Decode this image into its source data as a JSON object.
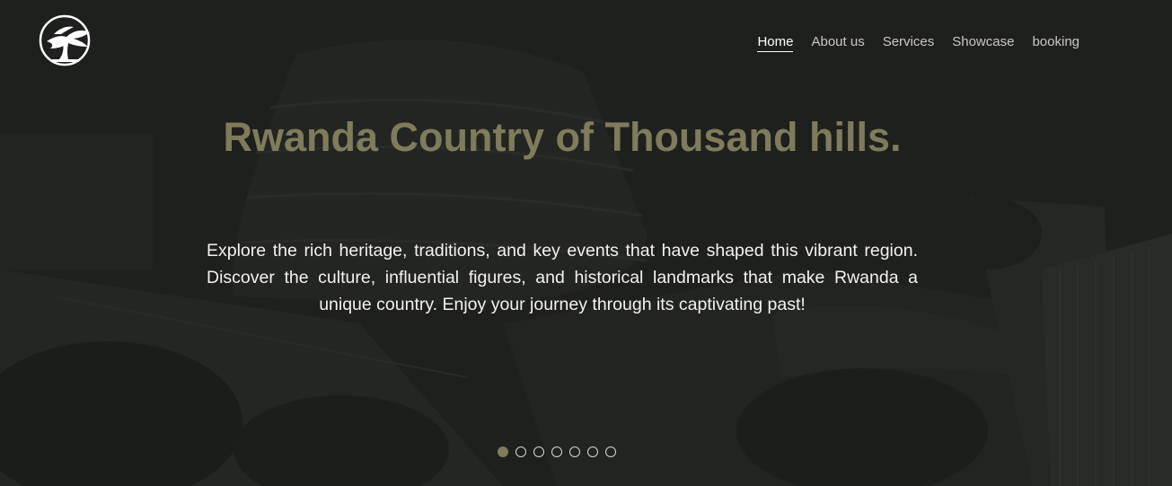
{
  "nav": {
    "items": [
      {
        "label": "Home",
        "active": true
      },
      {
        "label": "About us",
        "active": false
      },
      {
        "label": "Services",
        "active": false
      },
      {
        "label": "Showcase",
        "active": false
      },
      {
        "label": "booking",
        "active": false
      }
    ]
  },
  "hero": {
    "title": "Rwanda Country of Thousand hills.",
    "description": "Explore the rich heritage, traditions, and key events that have shaped this vibrant region. Discover the culture, influential figures, and historical landmarks that make Rwanda a unique country. Enjoy your journey through its captivating past!"
  },
  "carousel": {
    "slide_count": 7,
    "active_index": 0
  },
  "colors": {
    "accent": "#7f7b5b",
    "text": "#f2f2ee",
    "background": "#232523"
  },
  "icons": {
    "logo": "bonsai-tree-logo-icon"
  }
}
